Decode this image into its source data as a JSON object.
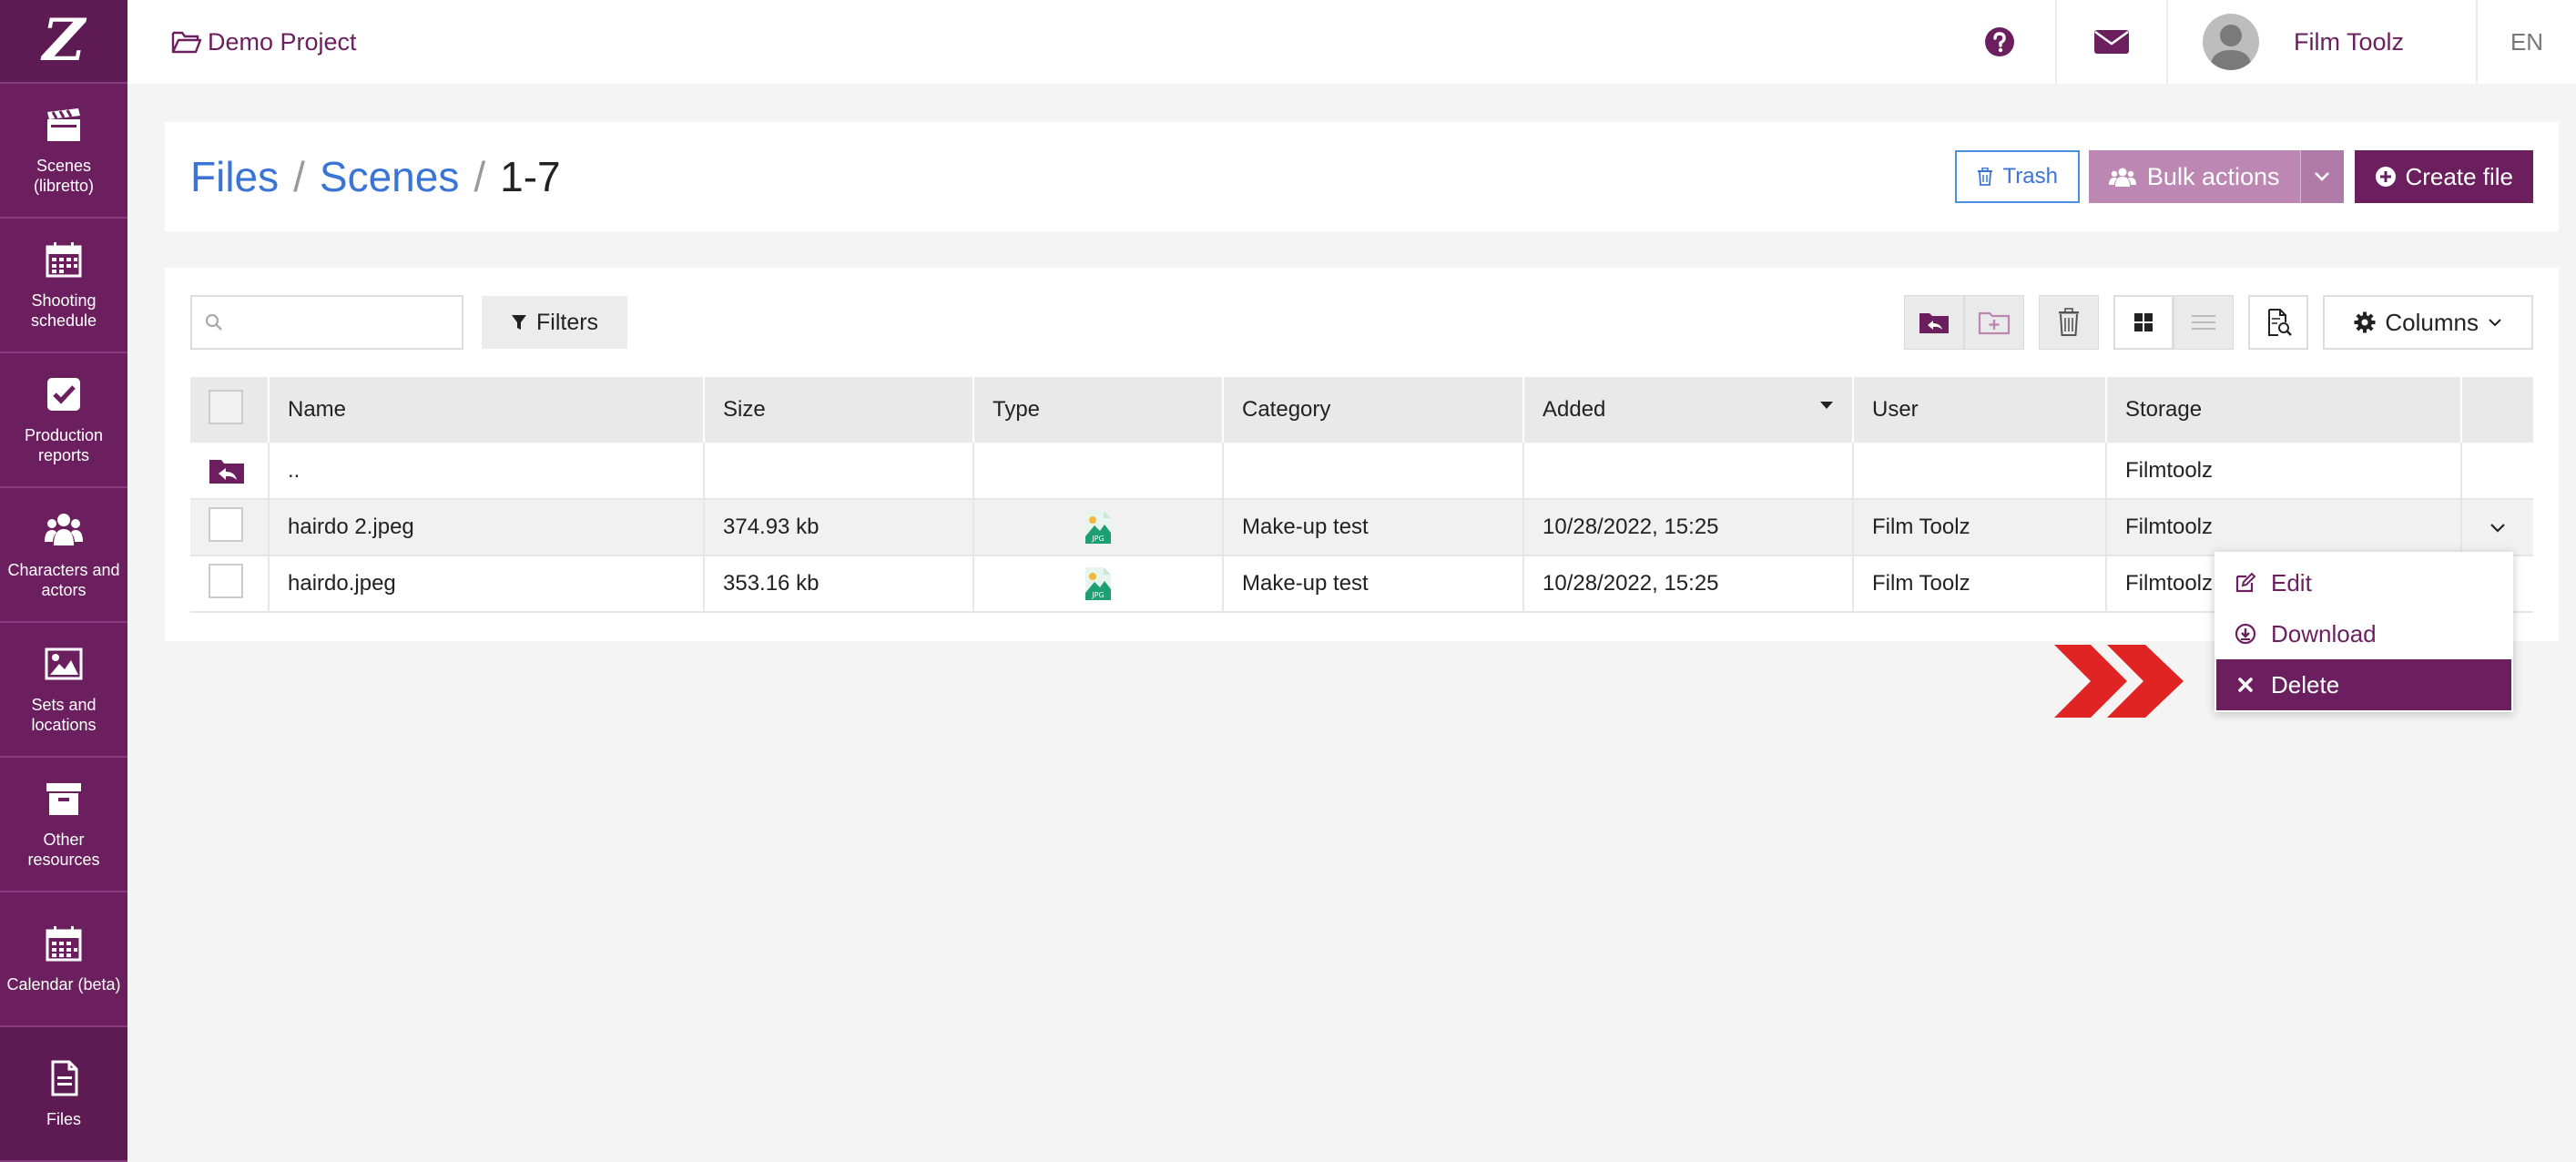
{
  "logo": "Z",
  "sidebar": {
    "items": [
      {
        "label": "Scenes (libretto)",
        "icon": "clapperboard-icon"
      },
      {
        "label": "Shooting schedule",
        "icon": "calendar-icon"
      },
      {
        "label": "Production reports",
        "icon": "checkbox-icon"
      },
      {
        "label": "Characters and actors",
        "icon": "users-icon"
      },
      {
        "label": "Sets and locations",
        "icon": "image-icon"
      },
      {
        "label": "Other resources",
        "icon": "archive-box-icon"
      },
      {
        "label": "Calendar (beta)",
        "icon": "calendar-grid-icon"
      },
      {
        "label": "Files",
        "icon": "file-icon"
      }
    ]
  },
  "topbar": {
    "project": "Demo Project",
    "user_name": "Film Toolz",
    "language": "EN"
  },
  "breadcrumb": {
    "items": [
      "Files",
      "Scenes"
    ],
    "separator": "/",
    "current": "1-7"
  },
  "header_actions": {
    "trash": "Trash",
    "bulk_actions": "Bulk actions",
    "create_file": "Create file"
  },
  "toolbar": {
    "search_placeholder": "",
    "filters": "Filters",
    "columns": "Columns"
  },
  "table": {
    "columns": [
      "Name",
      "Size",
      "Type",
      "Category",
      "Added",
      "User",
      "Storage"
    ],
    "parent_row": {
      "name": "..",
      "storage": "Filmtoolz"
    },
    "rows": [
      {
        "name": "hairdo 2.jpeg",
        "size": "374.93 kb",
        "type": "JPG",
        "category": "Make-up test",
        "added": "10/28/2022, 15:25",
        "user": "Film Toolz",
        "storage": "Filmtoolz"
      },
      {
        "name": "hairdo.jpeg",
        "size": "353.16 kb",
        "type": "JPG",
        "category": "Make-up test",
        "added": "10/28/2022, 15:25",
        "user": "Film Toolz",
        "storage": "Filmtoolz"
      }
    ]
  },
  "context_menu": {
    "items": [
      "Edit",
      "Download",
      "Delete"
    ],
    "active": "Delete"
  },
  "colors": {
    "brand": "#6b1f5f",
    "link": "#3a74d6",
    "arrow": "#e02424"
  }
}
